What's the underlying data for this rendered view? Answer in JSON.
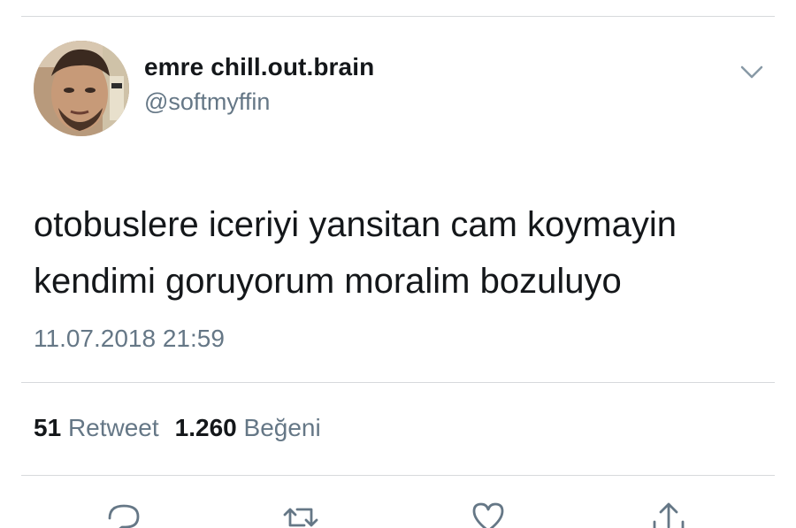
{
  "tweet": {
    "author": {
      "display_name": "emre chill.out.brain",
      "handle": "@softmyffin",
      "avatar_icon": "profile-photo"
    },
    "text_lines": [
      "otobuslere iceriyi yansitan cam koymayin",
      "kendimi goruyorum moralim bozuluyo"
    ],
    "timestamp": "11.07.2018 21:59",
    "stats": {
      "retweet_count": "51",
      "retweet_label": "Retweet",
      "like_count": "1.260",
      "like_label": "Beğeni"
    },
    "actions": [
      {
        "name": "reply",
        "icon": "reply-icon"
      },
      {
        "name": "retweet",
        "icon": "retweet-icon"
      },
      {
        "name": "like",
        "icon": "heart-icon"
      },
      {
        "name": "share",
        "icon": "share-icon"
      }
    ],
    "menu_icon": "chevron-down-icon"
  },
  "colors": {
    "text_primary": "#14171a",
    "text_secondary": "#657786",
    "divider": "#d7d9dc",
    "icon": "#657786"
  }
}
